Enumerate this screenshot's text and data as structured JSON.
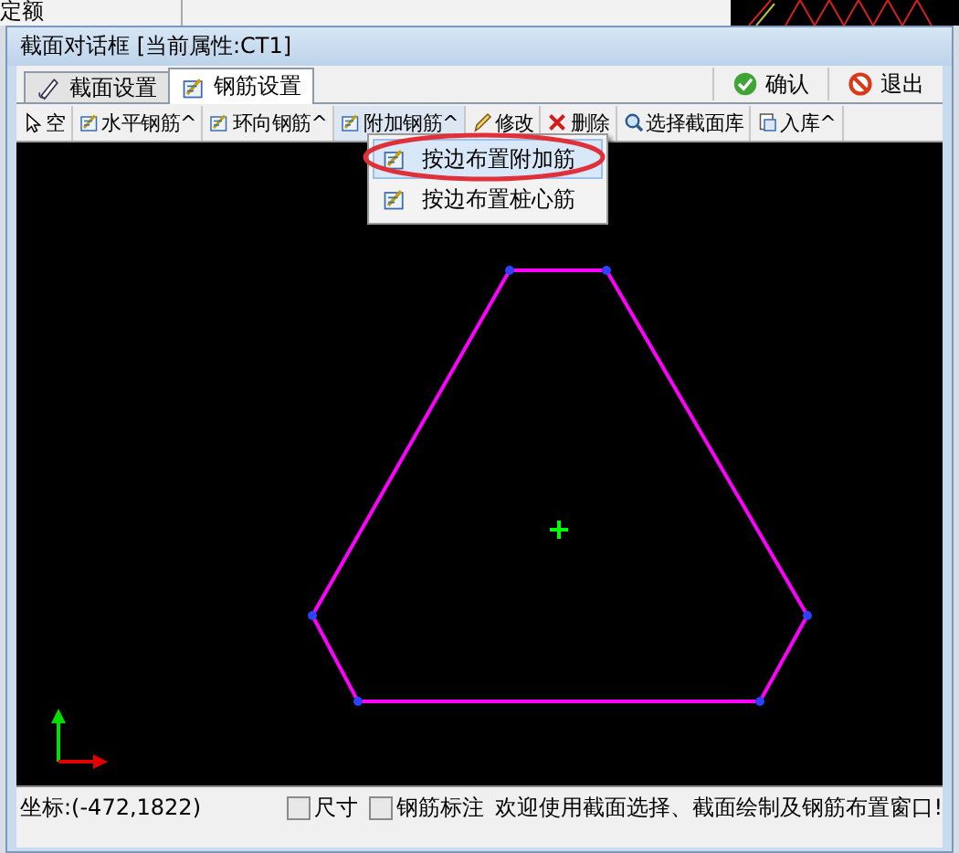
{
  "background": {
    "title_fragment": "定额"
  },
  "window": {
    "title": "截面对话框 [当前属性:CT1]"
  },
  "tabs": [
    {
      "label": "截面设置",
      "kind": "pen",
      "selected": false
    },
    {
      "label": "钢筋设置",
      "kind": "rebar",
      "selected": true
    }
  ],
  "actions": [
    {
      "label": "确认",
      "kind": "confirm"
    },
    {
      "label": "退出",
      "kind": "exit"
    }
  ],
  "toolbar": [
    {
      "label": "空",
      "kind": "pointer"
    },
    {
      "label": "水平钢筋",
      "kind": "rebar",
      "caret": "^"
    },
    {
      "label": "环向钢筋",
      "kind": "rebar",
      "caret": "^"
    },
    {
      "label": "附加钢筋",
      "kind": "rebar",
      "caret": "^",
      "expanded": true
    },
    {
      "label": "修改",
      "kind": "pencil"
    },
    {
      "label": "删除",
      "kind": "delete"
    },
    {
      "label": "选择截面库",
      "kind": "search"
    },
    {
      "label": "入库",
      "kind": "store",
      "caret": "^"
    }
  ],
  "menu": {
    "items": [
      {
        "label": "按边布置附加筋",
        "selected": true,
        "circled": true
      },
      {
        "label": "按边布置桩心筋",
        "selected": false,
        "circled": false
      }
    ]
  },
  "status_bar": {
    "coordinates": "坐标:(-472,1822)",
    "checkboxes": [
      {
        "label": "尺寸",
        "checked": false
      },
      {
        "label": "钢筋标注",
        "checked": false
      }
    ],
    "message": "欢迎使用截面选择、截面绘制及钢筋布置窗口!"
  }
}
